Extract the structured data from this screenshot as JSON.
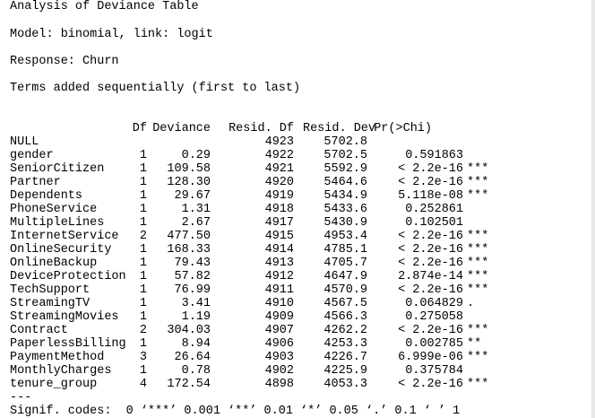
{
  "title": "Analysis of Deviance Table",
  "model": "Model: binomial, link: logit",
  "response": "Response: Churn",
  "terms_note": "Terms added sequentially (first to last)",
  "header": {
    "df": "Df",
    "deviance": "Deviance",
    "resid_df": "Resid. Df",
    "resid_dev": "Resid. Dev",
    "pr": "Pr(>Chi)"
  },
  "rows": [
    {
      "term": "NULL",
      "df": "",
      "deviance": "",
      "resid_df": "4923",
      "resid_dev": "5702.8",
      "pr": "",
      "sig": ""
    },
    {
      "term": "gender",
      "df": "1",
      "deviance": "0.29",
      "resid_df": "4922",
      "resid_dev": "5702.5",
      "pr": "0.591863",
      "sig": ""
    },
    {
      "term": "SeniorCitizen",
      "df": "1",
      "deviance": "109.58",
      "resid_df": "4921",
      "resid_dev": "5592.9",
      "pr": "< 2.2e-16",
      "sig": "***"
    },
    {
      "term": "Partner",
      "df": "1",
      "deviance": "128.30",
      "resid_df": "4920",
      "resid_dev": "5464.6",
      "pr": "< 2.2e-16",
      "sig": "***"
    },
    {
      "term": "Dependents",
      "df": "1",
      "deviance": "29.67",
      "resid_df": "4919",
      "resid_dev": "5434.9",
      "pr": "5.118e-08",
      "sig": "***"
    },
    {
      "term": "PhoneService",
      "df": "1",
      "deviance": "1.31",
      "resid_df": "4918",
      "resid_dev": "5433.6",
      "pr": "0.252861",
      "sig": ""
    },
    {
      "term": "MultipleLines",
      "df": "1",
      "deviance": "2.67",
      "resid_df": "4917",
      "resid_dev": "5430.9",
      "pr": "0.102501",
      "sig": ""
    },
    {
      "term": "InternetService",
      "df": "2",
      "deviance": "477.50",
      "resid_df": "4915",
      "resid_dev": "4953.4",
      "pr": "< 2.2e-16",
      "sig": "***"
    },
    {
      "term": "OnlineSecurity",
      "df": "1",
      "deviance": "168.33",
      "resid_df": "4914",
      "resid_dev": "4785.1",
      "pr": "< 2.2e-16",
      "sig": "***"
    },
    {
      "term": "OnlineBackup",
      "df": "1",
      "deviance": "79.43",
      "resid_df": "4913",
      "resid_dev": "4705.7",
      "pr": "< 2.2e-16",
      "sig": "***"
    },
    {
      "term": "DeviceProtection",
      "df": "1",
      "deviance": "57.82",
      "resid_df": "4912",
      "resid_dev": "4647.9",
      "pr": "2.874e-14",
      "sig": "***"
    },
    {
      "term": "TechSupport",
      "df": "1",
      "deviance": "76.99",
      "resid_df": "4911",
      "resid_dev": "4570.9",
      "pr": "< 2.2e-16",
      "sig": "***"
    },
    {
      "term": "StreamingTV",
      "df": "1",
      "deviance": "3.41",
      "resid_df": "4910",
      "resid_dev": "4567.5",
      "pr": "0.064829",
      "sig": "."
    },
    {
      "term": "StreamingMovies",
      "df": "1",
      "deviance": "1.19",
      "resid_df": "4909",
      "resid_dev": "4566.3",
      "pr": "0.275058",
      "sig": ""
    },
    {
      "term": "Contract",
      "df": "2",
      "deviance": "304.03",
      "resid_df": "4907",
      "resid_dev": "4262.2",
      "pr": "< 2.2e-16",
      "sig": "***"
    },
    {
      "term": "PaperlessBilling",
      "df": "1",
      "deviance": "8.94",
      "resid_df": "4906",
      "resid_dev": "4253.3",
      "pr": "0.002785",
      "sig": "**"
    },
    {
      "term": "PaymentMethod",
      "df": "3",
      "deviance": "26.64",
      "resid_df": "4903",
      "resid_dev": "4226.7",
      "pr": "6.999e-06",
      "sig": "***"
    },
    {
      "term": "MonthlyCharges",
      "df": "1",
      "deviance": "0.78",
      "resid_df": "4902",
      "resid_dev": "4225.9",
      "pr": "0.375784",
      "sig": ""
    },
    {
      "term": "tenure_group",
      "df": "4",
      "deviance": "172.54",
      "resid_df": "4898",
      "resid_dev": "4053.3",
      "pr": "< 2.2e-16",
      "sig": "***"
    }
  ],
  "separator": "---",
  "signif": "Signif. codes:  0 ‘***’ 0.001 ‘**’ 0.01 ‘*’ 0.05 ‘.’ 0.1 ‘ ’ 1"
}
